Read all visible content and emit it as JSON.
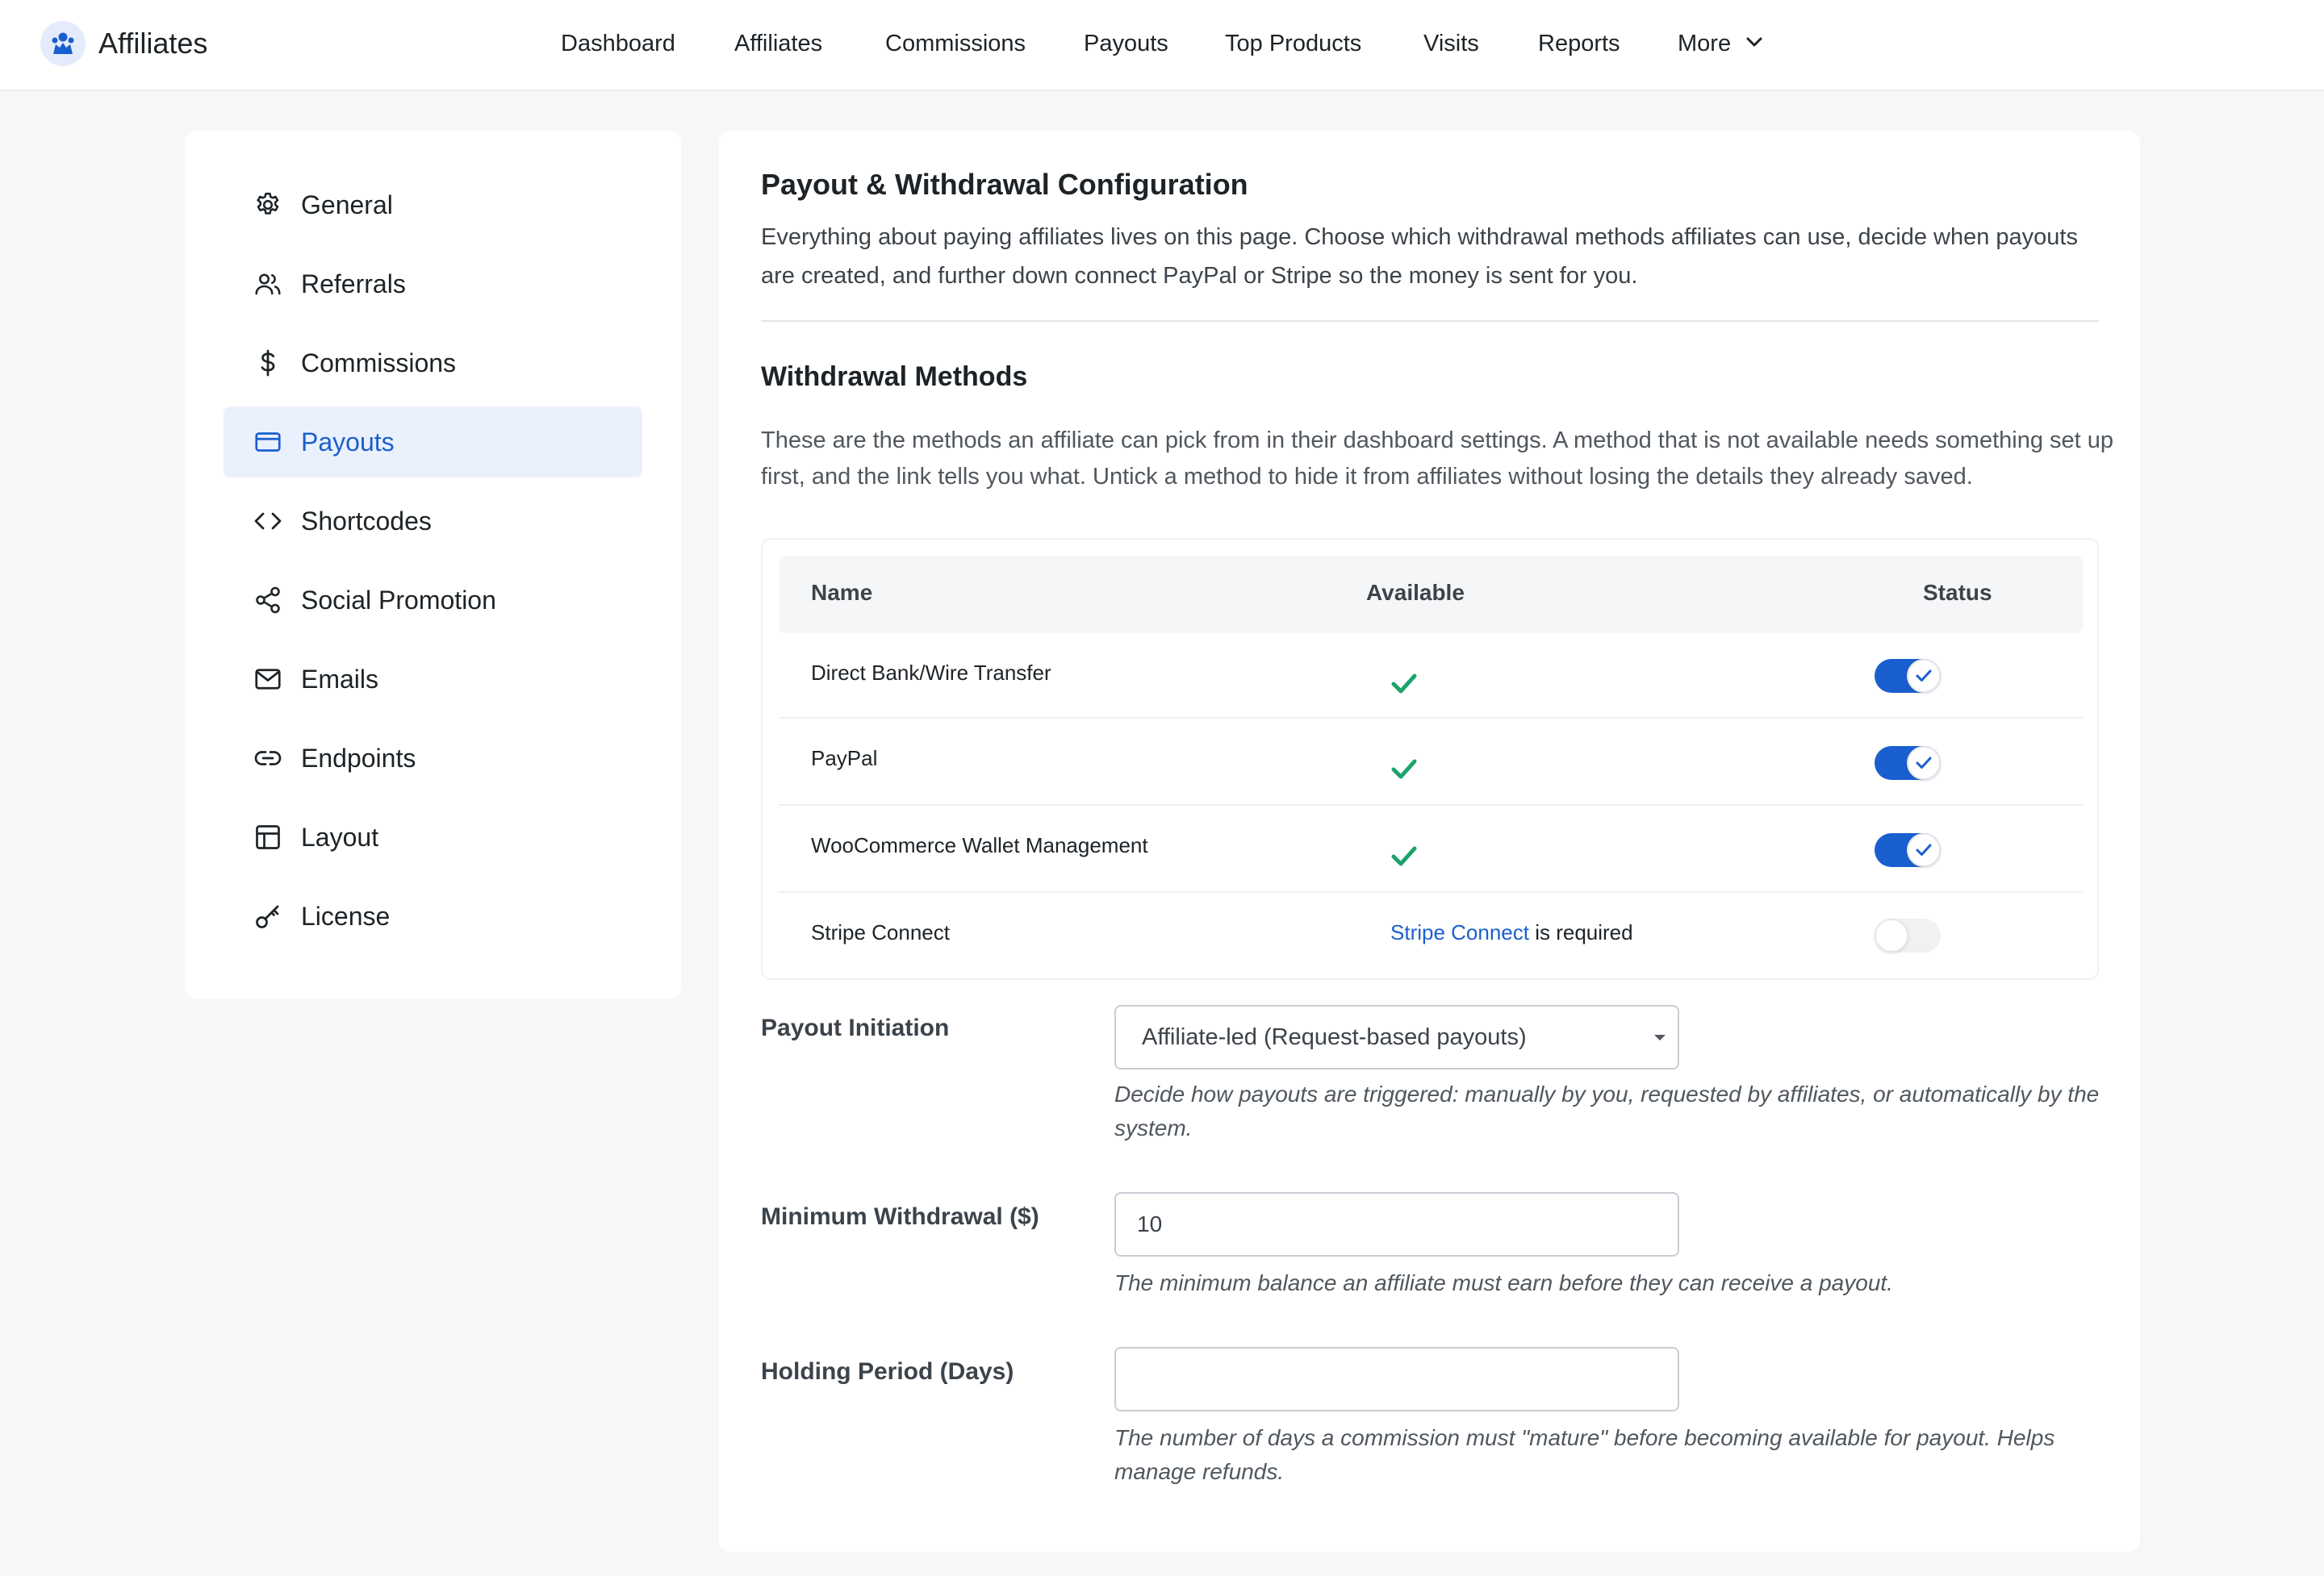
{
  "app": {
    "title": "Affiliates"
  },
  "topnav": {
    "items": [
      "Dashboard",
      "Affiliates",
      "Commissions",
      "Payouts",
      "Top Products",
      "Visits",
      "Reports",
      "More"
    ]
  },
  "sidebar": {
    "items": [
      {
        "label": "General",
        "icon": "gear-icon"
      },
      {
        "label": "Referrals",
        "icon": "users-icon"
      },
      {
        "label": "Commissions",
        "icon": "dollar-icon"
      },
      {
        "label": "Payouts",
        "icon": "credit-card-icon"
      },
      {
        "label": "Shortcodes",
        "icon": "code-icon"
      },
      {
        "label": "Social Promotion",
        "icon": "share-icon"
      },
      {
        "label": "Emails",
        "icon": "envelope-icon"
      },
      {
        "label": "Endpoints",
        "icon": "link-icon"
      },
      {
        "label": "Layout",
        "icon": "layout-icon"
      },
      {
        "label": "License",
        "icon": "key-icon"
      }
    ],
    "active_index": 3
  },
  "main": {
    "title": "Payout & Withdrawal Configuration",
    "intro": "Everything about paying affiliates lives on this page. Choose which withdrawal methods affiliates can use, decide when payouts are created, and further down connect PayPal or Stripe so the money is sent for you.",
    "methods": {
      "title": "Withdrawal Methods",
      "description": "These are the methods an affiliate can pick from in their dashboard settings. A method that is not available needs something set up first, and the link tells you what. Untick a method to hide it from affiliates without losing the details they already saved.",
      "columns": [
        "Name",
        "Available",
        "Status"
      ],
      "rows": [
        {
          "name": "Direct Bank/Wire Transfer",
          "available": true,
          "enabled": true
        },
        {
          "name": "PayPal",
          "available": true,
          "enabled": true
        },
        {
          "name": "WooCommerce Wallet Management",
          "available": true,
          "enabled": true
        },
        {
          "name": "Stripe Connect",
          "available": false,
          "enabled": false,
          "requirement_link": "Stripe Connect",
          "requirement_text": " is required"
        }
      ]
    },
    "payout_initiation": {
      "label": "Payout Initiation",
      "value": "Affiliate-led (Request-based payouts)",
      "help": "Decide how payouts are triggered: manually by you, requested by affiliates, or automatically by the system."
    },
    "minimum_withdrawal": {
      "label": "Minimum Withdrawal ($)",
      "value": "10",
      "help": "The minimum balance an affiliate must earn before they can receive a payout."
    },
    "holding_period": {
      "label": "Holding Period (Days)",
      "value": "",
      "help": "The number of days a commission must \"mature\" before becoming available for payout. Helps manage refunds."
    }
  },
  "colors": {
    "accent": "#1a5fd0",
    "check": "#1aa36b",
    "active_bg": "#ebf1fc",
    "page_bg": "#f6f7f9"
  }
}
